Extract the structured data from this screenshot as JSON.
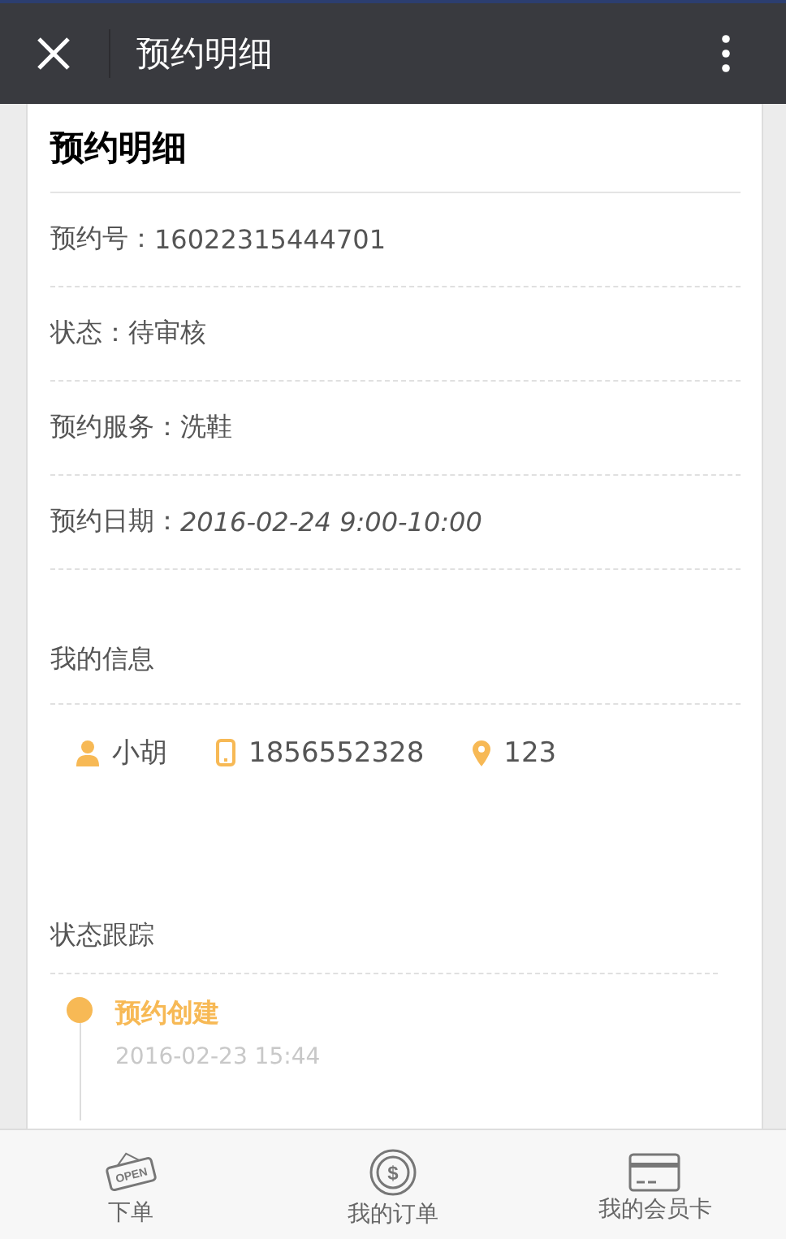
{
  "top_bar": {
    "title": "预约明细"
  },
  "card": {
    "heading": "预约明细",
    "fields": [
      {
        "label": "预约号：",
        "value": "16022315444701",
        "kind": "plain"
      },
      {
        "label": "状态：",
        "value": "待审核",
        "kind": "plain"
      },
      {
        "label": "预约服务：",
        "value": "洗鞋",
        "kind": "plain"
      },
      {
        "label": "预约日期：",
        "value": "2016-02-24 9:00-10:00",
        "kind": "date"
      }
    ],
    "my_info": {
      "heading": "我的信息",
      "items": [
        {
          "kind": "person",
          "text": "小胡"
        },
        {
          "kind": "phone",
          "text": "1856552328"
        },
        {
          "kind": "location",
          "text": "123"
        }
      ]
    },
    "tracking": {
      "heading": "状态跟踪",
      "events": [
        {
          "title": "预约创建",
          "time": "2016-02-23 15:44"
        }
      ]
    }
  },
  "bottom_nav": [
    {
      "kind": "open-sign",
      "icon_text": "OPEN",
      "label": "下单"
    },
    {
      "kind": "coin",
      "icon_text": "$",
      "label": "我的订单"
    },
    {
      "kind": "card",
      "label": "我的会员卡"
    }
  ]
}
